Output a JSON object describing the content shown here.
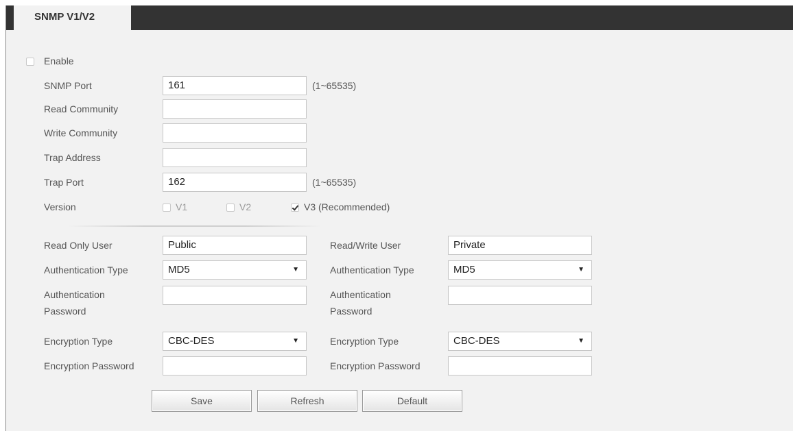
{
  "tab": {
    "label": "SNMP V1/V2"
  },
  "enable": {
    "label": "Enable",
    "checked": false
  },
  "snmp_port": {
    "label": "SNMP Port",
    "value": "161",
    "range": "(1~65535)"
  },
  "read_community": {
    "label": "Read Community",
    "value": ""
  },
  "write_community": {
    "label": "Write Community",
    "value": ""
  },
  "trap_address": {
    "label": "Trap Address",
    "value": ""
  },
  "trap_port": {
    "label": "Trap Port",
    "value": "162",
    "range": "(1~65535)"
  },
  "version": {
    "label": "Version",
    "options": [
      {
        "label": "V1",
        "checked": false
      },
      {
        "label": "V2",
        "checked": false
      },
      {
        "label": "V3 (Recommended)",
        "checked": true
      }
    ]
  },
  "left": {
    "user_label": "Read Only User",
    "user_value": "Public",
    "auth_type_label": "Authentication Type",
    "auth_type_value": "MD5",
    "auth_password_label": "Authentication Password",
    "auth_password_value": "",
    "enc_type_label": "Encryption Type",
    "enc_type_value": "CBC-DES",
    "enc_password_label": "Encryption Password",
    "enc_password_value": ""
  },
  "right": {
    "user_label": "Read/Write User",
    "user_value": "Private",
    "auth_type_label": "Authentication Type",
    "auth_type_value": "MD5",
    "auth_password_label": "Authentication Password",
    "auth_password_value": "",
    "enc_type_label": "Encryption Type",
    "enc_type_value": "CBC-DES",
    "enc_password_label": "Encryption Password",
    "enc_password_value": ""
  },
  "buttons": {
    "save": "Save",
    "refresh": "Refresh",
    "default": "Default"
  },
  "icons": {
    "dropdown": "chevron-down-icon",
    "checkbox": "checkbox-icon"
  }
}
